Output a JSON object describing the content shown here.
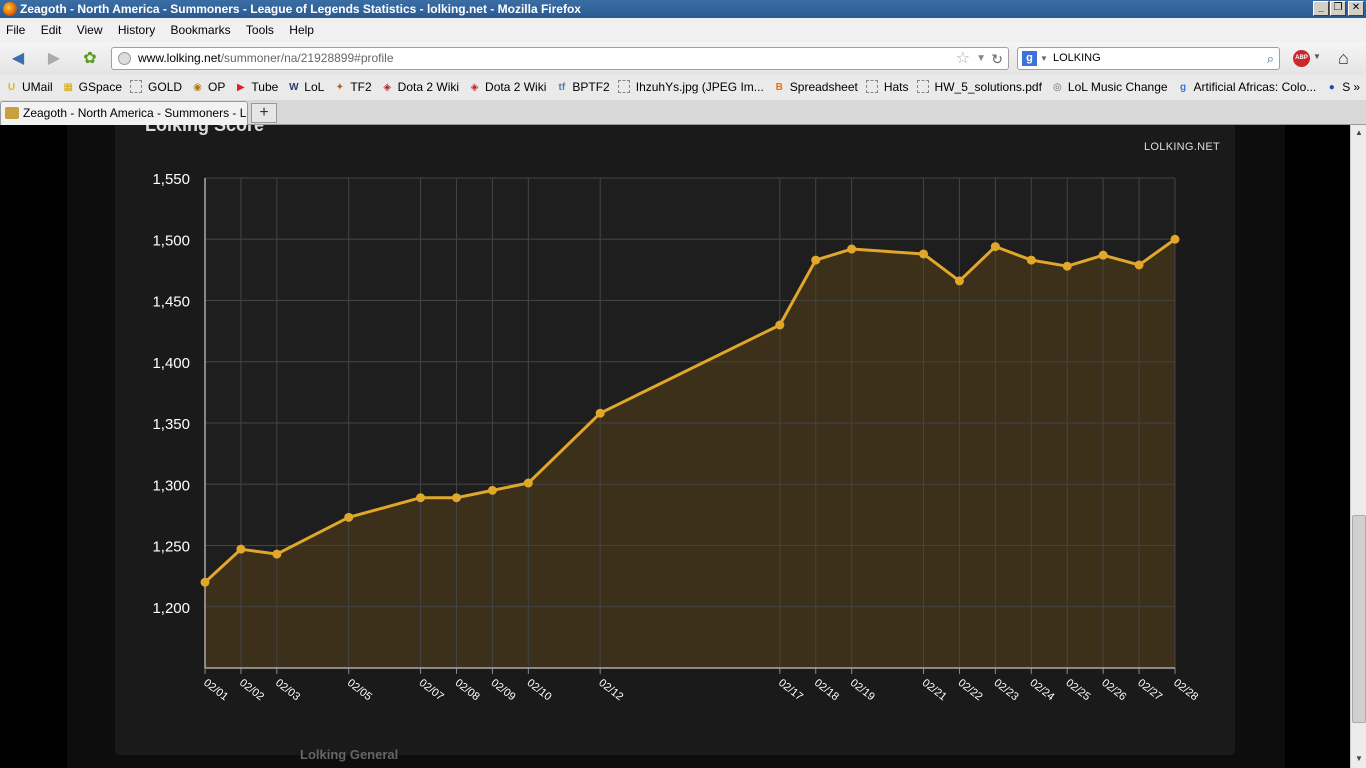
{
  "window": {
    "title": "Zeagoth - North America - Summoners - League of Legends Statistics - lolking.net - Mozilla Firefox"
  },
  "menu": [
    "File",
    "Edit",
    "View",
    "History",
    "Bookmarks",
    "Tools",
    "Help"
  ],
  "nav": {
    "url_host": "www.lolking.net",
    "url_path": "/summoner/na/21928899#profile",
    "search_value": "LOLKING"
  },
  "bookmarks": [
    {
      "label": "UMail",
      "icon": "U",
      "color": "#e8b800"
    },
    {
      "label": "GSpace",
      "icon": "▦",
      "color": "#d4a800"
    },
    {
      "label": "GOLD",
      "icon": "",
      "color": ""
    },
    {
      "label": "OP",
      "icon": "◉",
      "color": "#b07a10"
    },
    {
      "label": "Tube",
      "icon": "▶",
      "color": "#e02020"
    },
    {
      "label": "LoL",
      "icon": "W",
      "color": "#2a3c6a"
    },
    {
      "label": "TF2",
      "icon": "✦",
      "color": "#c05a10"
    },
    {
      "label": "Dota 2 Wiki",
      "icon": "◈",
      "color": "#c02020"
    },
    {
      "label": "Dota 2 Wiki",
      "icon": "◈",
      "color": "#c02020"
    },
    {
      "label": "BPTF2",
      "icon": "tf",
      "color": "#5a7aa8"
    },
    {
      "label": "IhzuhYs.jpg (JPEG Im...",
      "icon": "",
      "color": ""
    },
    {
      "label": "Spreadsheet",
      "icon": "B",
      "color": "#e8701a"
    },
    {
      "label": "Hats",
      "icon": "",
      "color": ""
    },
    {
      "label": "HW_5_solutions.pdf",
      "icon": "",
      "color": ""
    },
    {
      "label": "LoL Music Change",
      "icon": "◎",
      "color": "#666"
    },
    {
      "label": "Artificial Africas: Colo...",
      "icon": "g",
      "color": "#3b73d8"
    },
    {
      "label": "S",
      "icon": "●",
      "color": "#2a4aa8"
    }
  ],
  "bookmarks_more": "»",
  "tab": {
    "label": "Zeagoth - North America - Summoners - Lea...",
    "new_tab": "+"
  },
  "page": {
    "panel_title": "Lolking Score",
    "brand": "LOLKING.NET",
    "below_text": "Lolking General"
  },
  "colors": {
    "line": "#e0a72a",
    "area": "#3f321b",
    "plot_bg": "#1e1e1e",
    "grid": "#444444",
    "axis_text": "#ffffff"
  },
  "chart_data": {
    "type": "area",
    "title": "Lolking Score",
    "xlabel": "",
    "ylabel": "",
    "ylim": [
      1150,
      1550
    ],
    "yticks": [
      "1,200",
      "1,250",
      "1,300",
      "1,350",
      "1,400",
      "1,450",
      "1,500",
      "1,550"
    ],
    "ytick_values": [
      1200,
      1250,
      1300,
      1350,
      1400,
      1450,
      1500,
      1550
    ],
    "x": [
      "02/01",
      "02/02",
      "02/03",
      "02/05",
      "02/07",
      "02/08",
      "02/09",
      "02/10",
      "02/12",
      "02/17",
      "02/18",
      "02/19",
      "02/21",
      "02/22",
      "02/23",
      "02/24",
      "02/25",
      "02/26",
      "02/27",
      "02/28"
    ],
    "x_day": [
      1,
      2,
      3,
      5,
      7,
      8,
      9,
      10,
      12,
      17,
      18,
      19,
      21,
      22,
      23,
      24,
      25,
      26,
      27,
      28
    ],
    "series": [
      {
        "values": [
          1220,
          1247,
          1243,
          1273,
          1289,
          1289,
          1295,
          1301,
          1358,
          1430,
          1483,
          1492,
          1488,
          1466,
          1494,
          1483,
          1478,
          1487,
          1479,
          1500
        ]
      }
    ],
    "grid": true,
    "legend": "none"
  }
}
